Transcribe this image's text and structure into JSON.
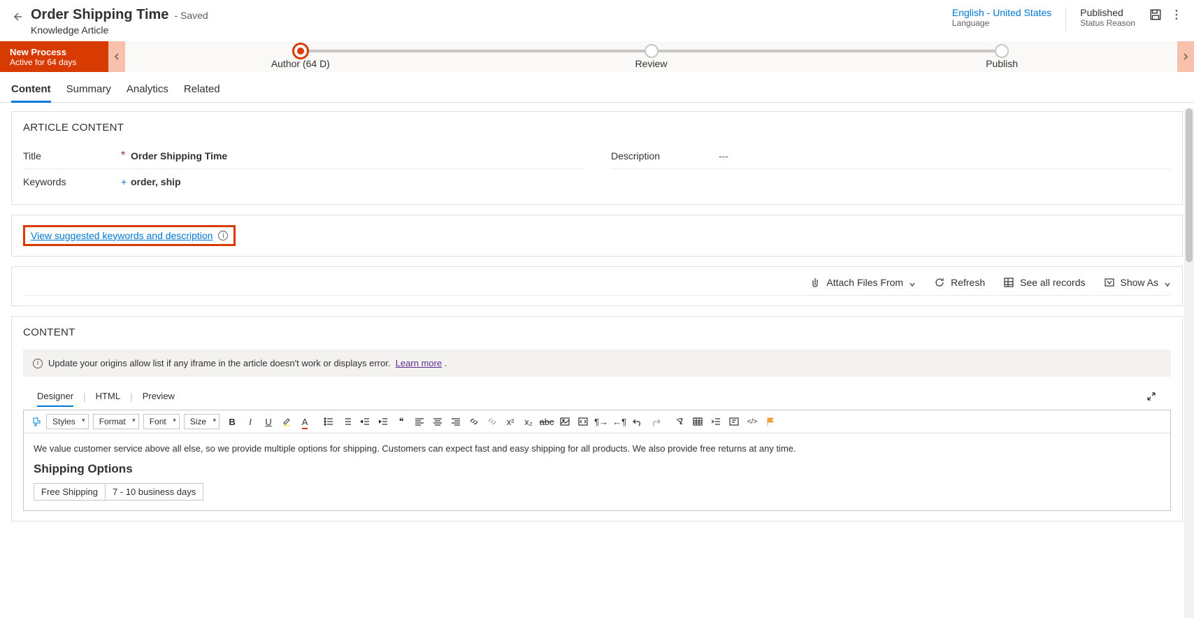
{
  "header": {
    "title": "Order Shipping Time",
    "saved_label": "- Saved",
    "subtitle": "Knowledge Article",
    "language": {
      "value": "English - United States",
      "label": "Language"
    },
    "status": {
      "value": "Published",
      "label": "Status Reason"
    }
  },
  "process": {
    "title": "New Process",
    "sub": "Active for 64 days",
    "stages": [
      {
        "label": "Author  (64 D)",
        "active": true
      },
      {
        "label": "Review",
        "active": false
      },
      {
        "label": "Publish",
        "active": false
      }
    ]
  },
  "tabs": [
    "Content",
    "Summary",
    "Analytics",
    "Related"
  ],
  "article": {
    "section_title": "ARTICLE CONTENT",
    "fields": {
      "title_label": "Title",
      "title_value": "Order Shipping Time",
      "keywords_label": "Keywords",
      "keywords_value": "order, ship",
      "description_label": "Description",
      "description_value": "---"
    }
  },
  "suggest": {
    "link_text": "View suggested keywords and description"
  },
  "toolbar": {
    "attach": "Attach Files From",
    "refresh": "Refresh",
    "see_all": "See all records",
    "show_as": "Show As"
  },
  "content": {
    "section_title": "CONTENT",
    "banner_text": "Update your origins allow list if any iframe in the article doesn't work or displays error.",
    "banner_link": "Learn more",
    "editor_tabs": [
      "Designer",
      "HTML",
      "Preview"
    ],
    "rte_selects": {
      "styles": "Styles",
      "format": "Format",
      "font": "Font",
      "size": "Size"
    },
    "body_p1": "We value customer service above all else, so we provide multiple options for shipping. Customers can expect fast and easy shipping for all products. We also provide free returns at any time.",
    "body_h": "Shipping Options",
    "table_row": {
      "c1": "Free Shipping",
      "c2": "7 - 10 business days"
    }
  }
}
